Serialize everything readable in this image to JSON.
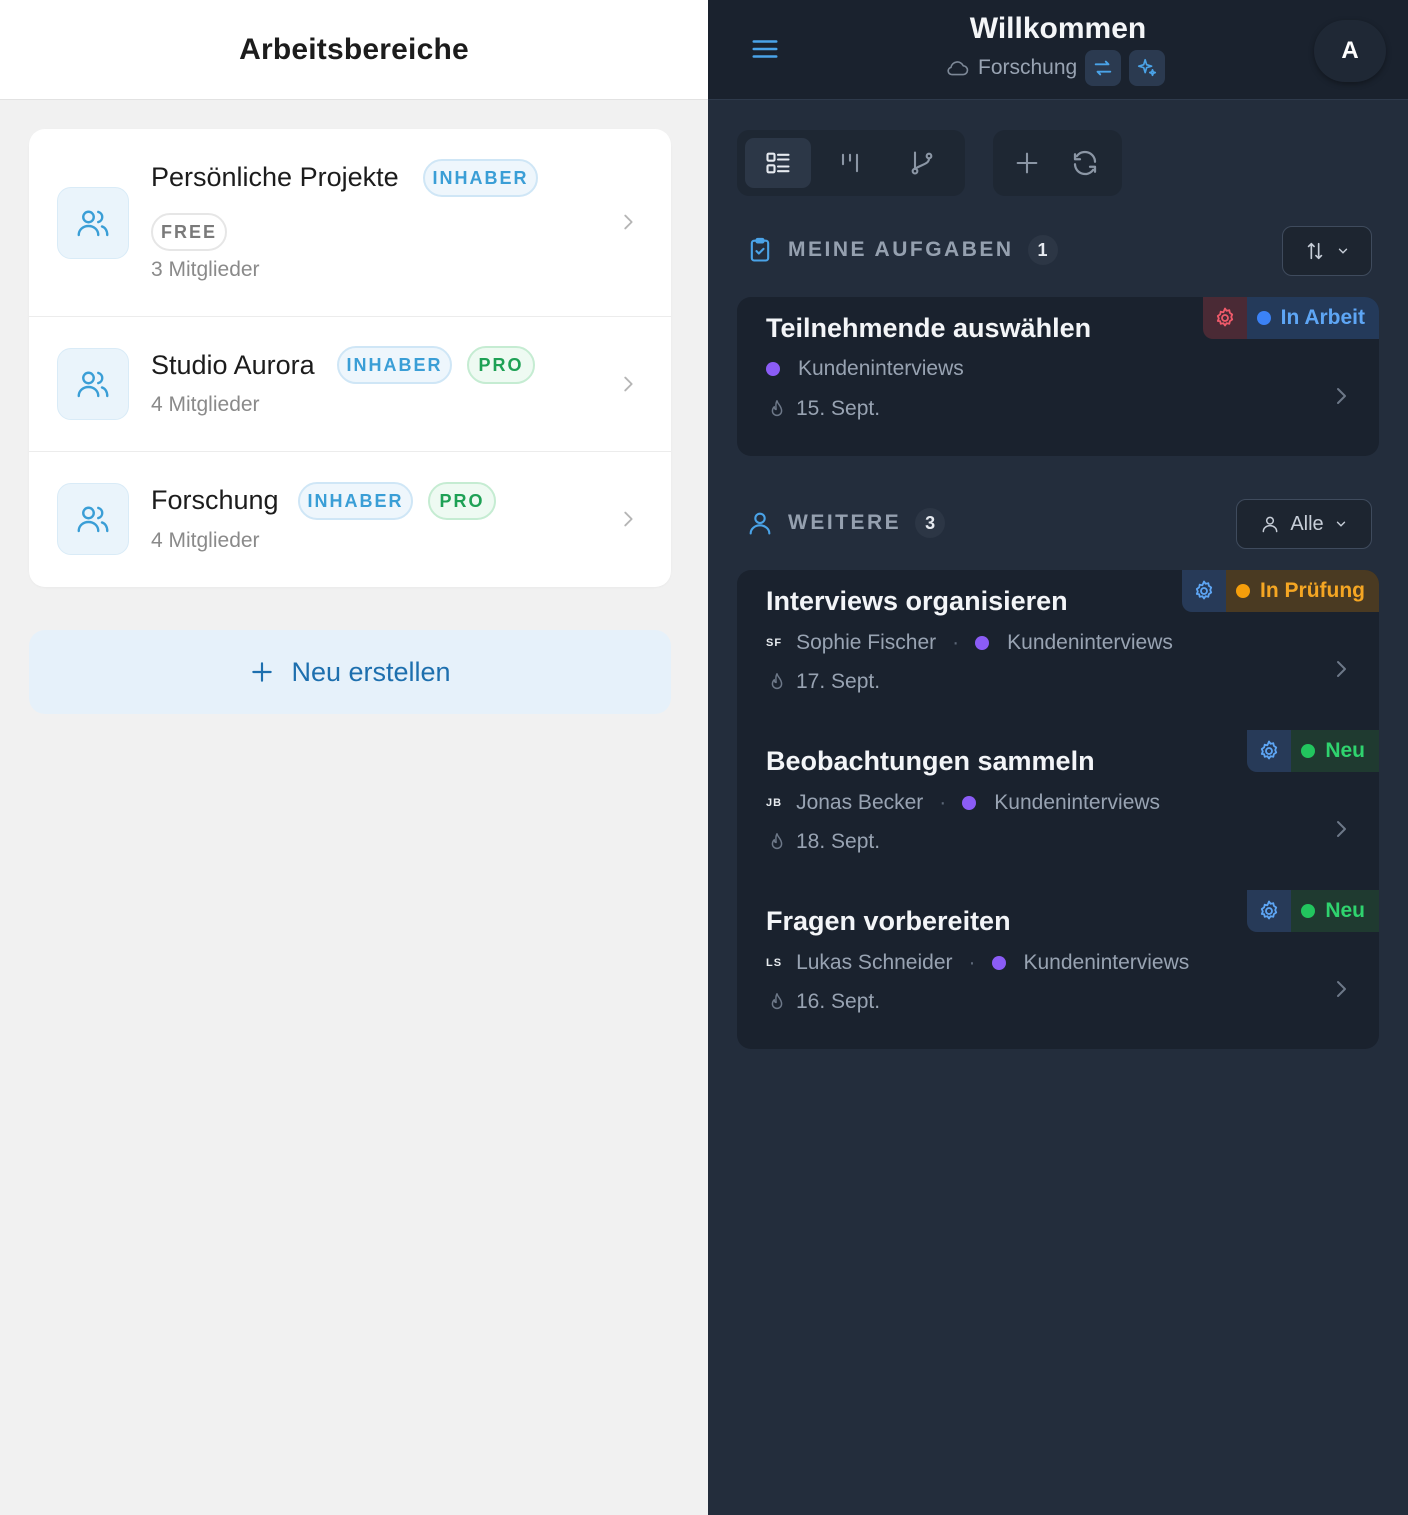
{
  "left": {
    "title": "Arbeitsbereiche",
    "workspaces": [
      {
        "name": "Persönliche Projekte",
        "role": "INHABER",
        "plan": "FREE",
        "members": "3 Mitglieder"
      },
      {
        "name": "Studio Aurora",
        "role": "INHABER",
        "plan": "PRO",
        "members": "4 Mitglieder"
      },
      {
        "name": "Forschung",
        "role": "INHABER",
        "plan": "PRO",
        "members": "4 Mitglieder"
      }
    ],
    "new_label": "Neu erstellen"
  },
  "right": {
    "title": "Willkommen",
    "workspace": "Forschung",
    "avatar": "A",
    "my_tasks": {
      "title": "MEINE AUFGABEN",
      "count": "1",
      "tasks": [
        {
          "title": "Teilnehmende auswählen",
          "project": "Kundeninterviews",
          "date": "15. Sept.",
          "status": "In Arbeit"
        }
      ]
    },
    "others": {
      "title": "WEITERE",
      "count": "3",
      "filter": "Alle",
      "tasks": [
        {
          "title": "Interviews organisieren",
          "initials": "SF",
          "assignee": "Sophie Fischer",
          "project": "Kundeninterviews",
          "date": "17. Sept.",
          "status": "In Prüfung"
        },
        {
          "title": "Beobachtungen sammeln",
          "initials": "JB",
          "assignee": "Jonas Becker",
          "project": "Kundeninterviews",
          "date": "18. Sept.",
          "status": "Neu"
        },
        {
          "title": "Fragen vorbereiten",
          "initials": "LS",
          "assignee": "Lukas Schneider",
          "project": "Kundeninterviews",
          "date": "16. Sept.",
          "status": "Neu"
        }
      ]
    },
    "colors": {
      "in_progress": "#3b82f6",
      "in_review": "#f59e0b",
      "new": "#22c55e",
      "project_dot": "#8b5cf6"
    }
  }
}
